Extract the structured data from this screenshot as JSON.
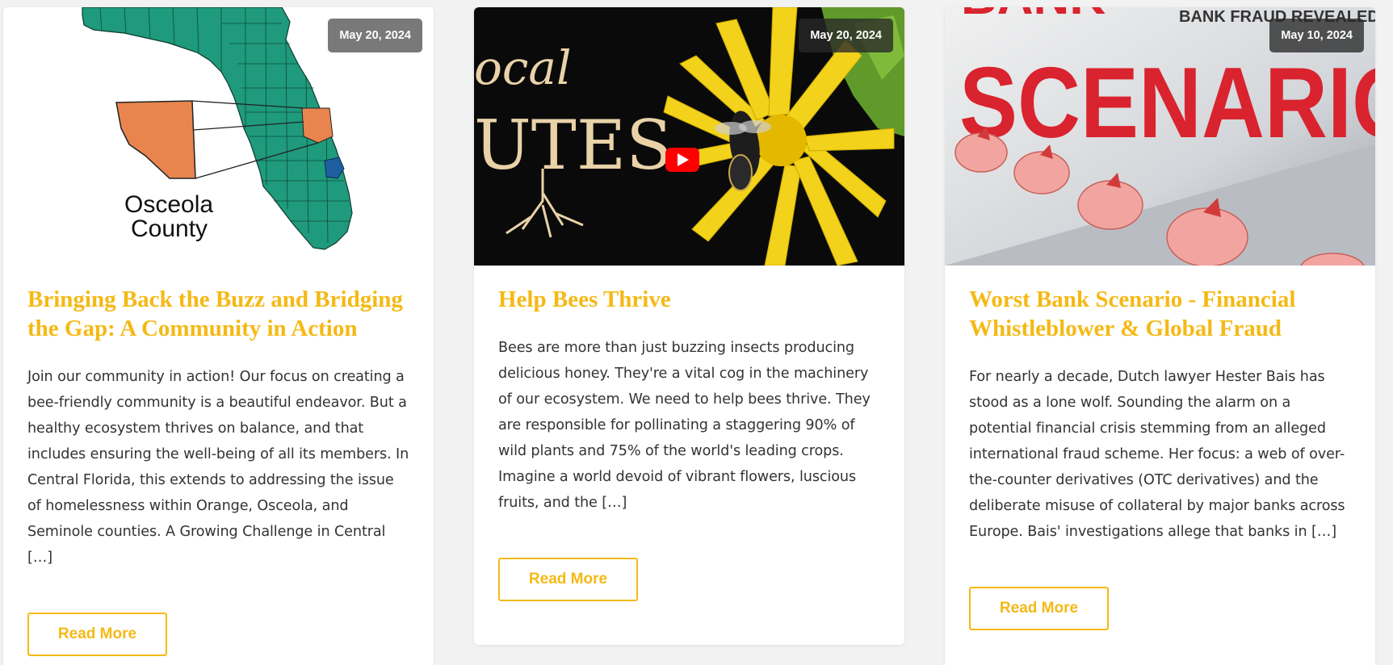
{
  "posts": [
    {
      "date": "May 20, 2024",
      "image_label_line1": "Osceola",
      "image_label_line2": "County",
      "title": "Bringing Back the Buzz and Bridging the Gap: A Community in Action",
      "excerpt": "Join our community in action! Our focus on creating a bee-friendly community is a beautiful endeavor. But a healthy ecosystem thrives on balance, and that includes ensuring the well-being of all its members. In Central Florida, this extends to addressing the issue of homelessness within Orange, Osceola, and Seminole counties. A Growing Challenge in Central […]",
      "button": "Read More"
    },
    {
      "date": "May 20, 2024",
      "image_text_1": "ocal",
      "image_text_2": "UTES",
      "play_icon": "youtube-play-icon",
      "title": "Help Bees Thrive",
      "excerpt": "Bees are more than just buzzing insects producing delicious honey. They're a vital cog in the machinery of our ecosystem. We need to help bees thrive. They are responsible for pollinating a staggering 90% of wild plants and 75% of the world's leading crops. Imagine a world devoid of vibrant flowers, luscious fruits, and the […]",
      "button": "Read More"
    },
    {
      "date": "May 10, 2024",
      "image_text_top": "BANK FRAUD REVEALED",
      "image_text_main": "SCENARIO",
      "image_text_clipped": "BANK",
      "title": "Worst Bank Scenario - Financial Whistleblower & Global Fraud",
      "excerpt": "For nearly a decade, Dutch lawyer Hester Bais has stood as a lone wolf. Sounding the alarm on a potential financial crisis stemming from an alleged international fraud scheme. Her focus: a web of over-the-counter derivatives (OTC derivatives) and the deliberate misuse of collateral by major banks across Europe. Bais' investigations allege that banks in […]",
      "button": "Read More"
    }
  ],
  "colors": {
    "accent": "#f5b915",
    "text": "#333333",
    "florida_green": "#1f9a7c",
    "county_orange": "#e8854e",
    "youtube_red": "#ff0000",
    "scenario_red": "#d9232e"
  }
}
